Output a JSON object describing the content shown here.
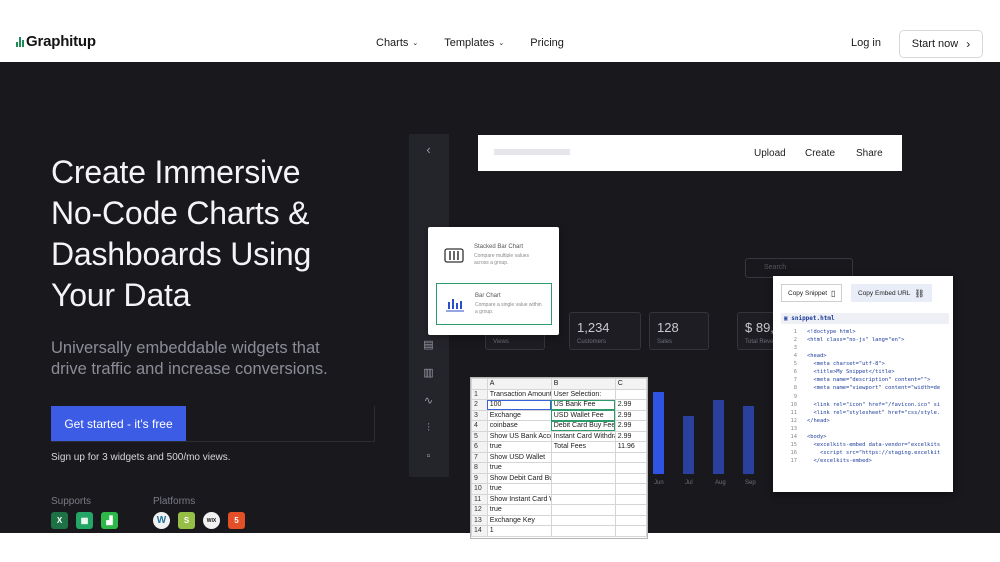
{
  "brand": {
    "name": "Graphitup",
    "accent": "#3d5ce6",
    "logo_green": "#1f8a55"
  },
  "nav": {
    "items": [
      {
        "label": "Charts",
        "has_dropdown": true
      },
      {
        "label": "Templates",
        "has_dropdown": true
      },
      {
        "label": "Pricing",
        "has_dropdown": false
      }
    ],
    "login": "Log in",
    "start": "Start now",
    "start_icon": "chevron-right-icon"
  },
  "hero": {
    "headline_lines": [
      "Create Immersive",
      "No-Code Charts &",
      "Dashboards Using",
      "Your Data"
    ],
    "subtitle_lines": [
      "Universally embeddable widgets that",
      "drive traffic and increase conversions."
    ],
    "cta": "Get started - it's free",
    "signup_note": "Sign up for 3 widgets and 500/mo views.",
    "supports_label": "Supports",
    "supports_icons": [
      "excel-icon",
      "google-sheets-icon",
      "numbers-icon"
    ],
    "platforms_label": "Platforms",
    "platforms_icons": [
      "wordpress-icon",
      "shopify-icon",
      "wix-icon",
      "html5-icon"
    ]
  },
  "dashboard": {
    "toolbar": {
      "upload": "Upload",
      "create": "Create",
      "share": "Share"
    },
    "search_placeholder": "Search",
    "stats": [
      {
        "value": "",
        "label": "Views"
      },
      {
        "value": "1,234",
        "label": "Customers"
      },
      {
        "value": "128",
        "label": "Sales"
      },
      {
        "value": "$ 89,",
        "label": "Total Reve"
      }
    ],
    "months": [
      "Jun",
      "Jul",
      "Aug",
      "Sep"
    ],
    "picker": [
      {
        "title": "Stacked Bar Chart",
        "desc": "Compare multiple values across a group.",
        "selected": false
      },
      {
        "title": "Bar Chart",
        "desc": "Compare a single value within a group.",
        "selected": true
      }
    ],
    "sheet": {
      "columns": [
        "",
        "A",
        "B",
        "C"
      ],
      "rows": [
        [
          "1",
          "Transaction Amount",
          "User Selection:",
          ""
        ],
        [
          "2",
          "100",
          "US Bank Fee",
          "2.99"
        ],
        [
          "3",
          "Exchange",
          "USD Wallet Fee",
          "2.99"
        ],
        [
          "4",
          "coinbase",
          "Debit Card Buy Fee",
          "2.99"
        ],
        [
          "5",
          "Show US Bank Account",
          "Instant Card Withdraw",
          "2.99"
        ],
        [
          "6",
          "true",
          "Total Fees",
          "11.96"
        ],
        [
          "7",
          "Show USD Wallet",
          "",
          ""
        ],
        [
          "8",
          "true",
          "",
          ""
        ],
        [
          "9",
          "Show Debit Card Buy",
          "",
          ""
        ],
        [
          "10",
          "true",
          "",
          ""
        ],
        [
          "11",
          "Show Instant Card Withdraw",
          "",
          ""
        ],
        [
          "12",
          "true",
          "",
          ""
        ],
        [
          "13",
          "Exchange Key",
          "",
          ""
        ],
        [
          "14",
          "1",
          "",
          ""
        ]
      ]
    },
    "embed": {
      "copy_snippet": "Copy Snippet",
      "copy_embed": "Copy Embed URL",
      "file_name": "snippet.html",
      "lines": [
        "<!doctype html>",
        "<html class=\"no-js\" lang=\"en\">",
        "",
        "<head>",
        "  <meta charset=\"utf-8\">",
        "  <title>My Snippet</title>",
        "  <meta name=\"description\" content=\"\">",
        "  <meta name=\"viewport\" content=\"width=de",
        "",
        "  <link rel=\"icon\" href=\"/favicon.ico\" si",
        "  <link rel=\"stylesheet\" href=\"css/style.",
        "</head>",
        "",
        "<body>",
        "  <excelkits-embed data-vendor=\"excelkits",
        "    <script src=\"https://staging.excelkit",
        "  </excelkits-embed>"
      ]
    }
  }
}
